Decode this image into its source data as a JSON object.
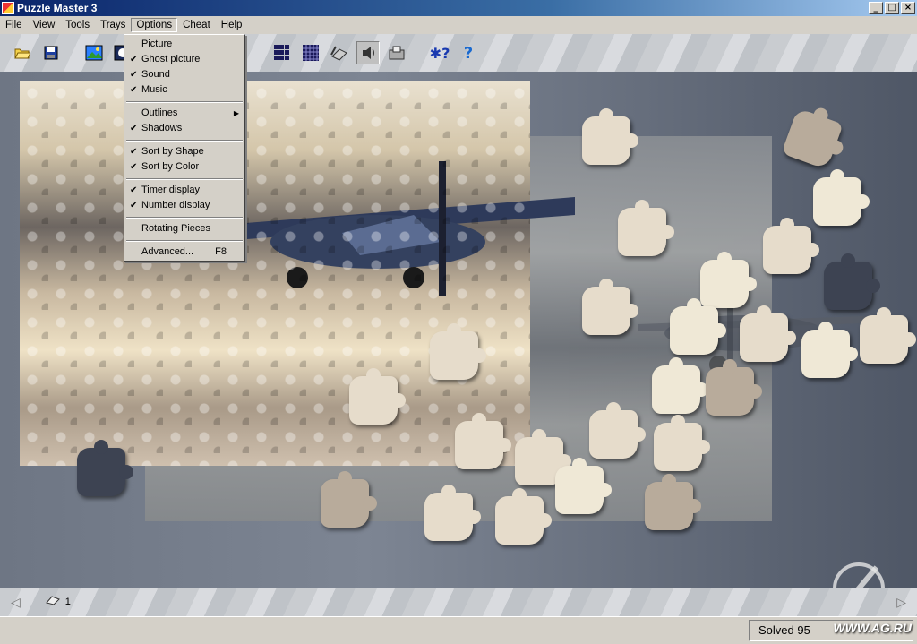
{
  "window": {
    "title": "Puzzle Master 3",
    "min_label": "_",
    "max_label": "□",
    "close_label": "×"
  },
  "menubar": {
    "items": [
      "File",
      "View",
      "Tools",
      "Trays",
      "Options",
      "Cheat",
      "Help"
    ]
  },
  "options_menu": {
    "picture": "Picture",
    "ghost_picture": "Ghost picture",
    "sound": "Sound",
    "music": "Music",
    "outlines": "Outlines",
    "shadows": "Shadows",
    "sort_by_shape": "Sort by Shape",
    "sort_by_color": "Sort by Color",
    "timer_display": "Timer display",
    "number_display": "Number display",
    "rotating_pieces": "Rotating Pieces",
    "advanced": "Advanced...",
    "advanced_shortcut": "F8",
    "check": "✔",
    "submenu_arrow": "▶"
  },
  "toolbar": {
    "icons": [
      "open-icon",
      "save-icon",
      "picture-icon",
      "ghost-icon",
      "grid-icon",
      "grid-fine-icon",
      "scan-icon",
      "sound-icon",
      "tray-icon",
      "help-context-icon",
      "help-icon"
    ]
  },
  "tray": {
    "left_arrow": "◁",
    "right_arrow": "▷",
    "count": "1"
  },
  "status": {
    "text": "Solved 95",
    "site": "WWW.AG.RU"
  },
  "colors": {
    "title_bar": "#0a246a",
    "workspace": "#7d8593"
  }
}
